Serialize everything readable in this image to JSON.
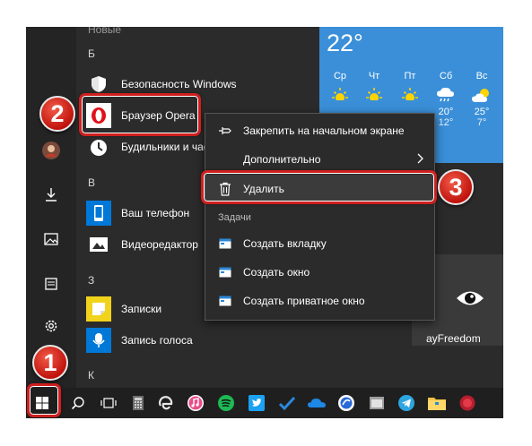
{
  "app_list": {
    "partial_top_label": "Новые",
    "groups": [
      {
        "letter": "Б",
        "apps": [
          {
            "label": "Безопасность Windows",
            "icon": "shield-icon"
          },
          {
            "label": "Браузер Opera",
            "icon": "opera-icon"
          },
          {
            "label": "Будильники и часы",
            "icon": "alarm-clock-icon"
          }
        ]
      },
      {
        "letter": "В",
        "apps": [
          {
            "label": "Ваш телефон",
            "icon": "phone-icon"
          },
          {
            "label": "Видеоредактор",
            "icon": "video-editor-icon"
          }
        ]
      },
      {
        "letter": "З",
        "apps": [
          {
            "label": "Записки",
            "icon": "sticky-notes-icon"
          },
          {
            "label": "Запись голоса",
            "icon": "microphone-icon"
          }
        ]
      },
      {
        "letter": "К",
        "apps": []
      }
    ]
  },
  "weather": {
    "temperature": "22°",
    "days": [
      {
        "name": "Ср",
        "icon": "sun-icon",
        "high": "",
        "low": ""
      },
      {
        "name": "Чт",
        "icon": "sun-icon",
        "high": "",
        "low": ""
      },
      {
        "name": "Пт",
        "icon": "sun-icon",
        "high": "",
        "low": ""
      },
      {
        "name": "Сб",
        "icon": "rain-icon",
        "high": "20°",
        "low": "12°"
      },
      {
        "name": "Вс",
        "icon": "partly-cloudy-icon",
        "high": "25°",
        "low": "7°"
      }
    ]
  },
  "tiles": {
    "freedom_label": "ayFreedom"
  },
  "context_menu": {
    "pin_label": "Закрепить на начальном экране",
    "more_label": "Дополнительно",
    "delete_label": "Удалить",
    "tasks_header": "Задачи",
    "tasks": [
      "Создать вкладку",
      "Создать окно",
      "Создать приватное окно"
    ]
  },
  "badges": {
    "one": "1",
    "two": "2",
    "three": "3"
  },
  "colors": {
    "highlight": "#cf1f1f",
    "badge": "#d9231b",
    "weather_tile": "#3a8fd8",
    "opera_red": "#e0111b"
  }
}
